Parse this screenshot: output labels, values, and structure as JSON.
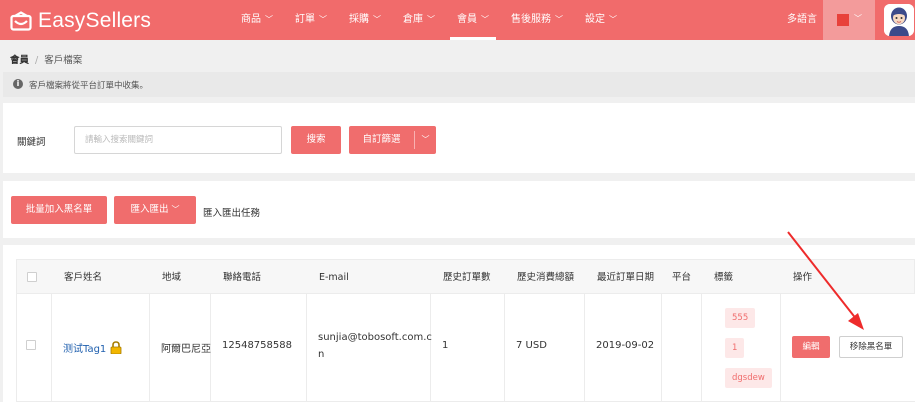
{
  "app": {
    "logo_text": "EasySellers",
    "brand_color": "#f16b6b"
  },
  "nav": {
    "items": [
      {
        "label": "商品",
        "has_dropdown": true
      },
      {
        "label": "訂單",
        "has_dropdown": true
      },
      {
        "label": "採購",
        "has_dropdown": true
      },
      {
        "label": "倉庫",
        "has_dropdown": true
      },
      {
        "label": "會員",
        "has_dropdown": true,
        "active": true
      },
      {
        "label": "售後服務",
        "has_dropdown": true
      },
      {
        "label": "設定",
        "has_dropdown": true
      }
    ],
    "user_name": "多語言",
    "color_swatch": "#e8413a"
  },
  "breadcrumb": {
    "current": "會員",
    "separator": "/",
    "page": "客戶檔案"
  },
  "notice": {
    "icon": "info-icon",
    "text": "客戶檔案將從平台訂單中收集。"
  },
  "search": {
    "label": "關鍵詞",
    "placeholder": "請輸入搜索關鍵詞",
    "search_label": "搜索",
    "filter_label": "自訂篩選"
  },
  "actions": {
    "bulk_blacklist_label": "批量加入黑名單",
    "import_export_label": "匯入匯出",
    "task_link_label": "匯入匯出任務"
  },
  "table": {
    "headers": [
      "客戶姓名",
      "地域",
      "聯絡電話",
      "E-mail",
      "歷史訂單數",
      "歷史消費總額",
      "最近訂單日期",
      "平台",
      "標籤",
      "操作"
    ],
    "rows": [
      {
        "name": "测试Tag1",
        "locked": true,
        "region": "阿爾巴尼亞",
        "phone": "12548758588",
        "email_line1": "sunjia@tobosoft.com.c",
        "email_line2": "n",
        "order_count": "1",
        "total_spend": "7 USD",
        "last_order_date": "2019-09-02",
        "platform": "",
        "tags": [
          "555",
          "1",
          "dgsdew"
        ],
        "edit_label": "編輯",
        "remove_label": "移除黑名單"
      }
    ]
  },
  "annotation": {
    "arrow_color": "#ee2b2b"
  }
}
